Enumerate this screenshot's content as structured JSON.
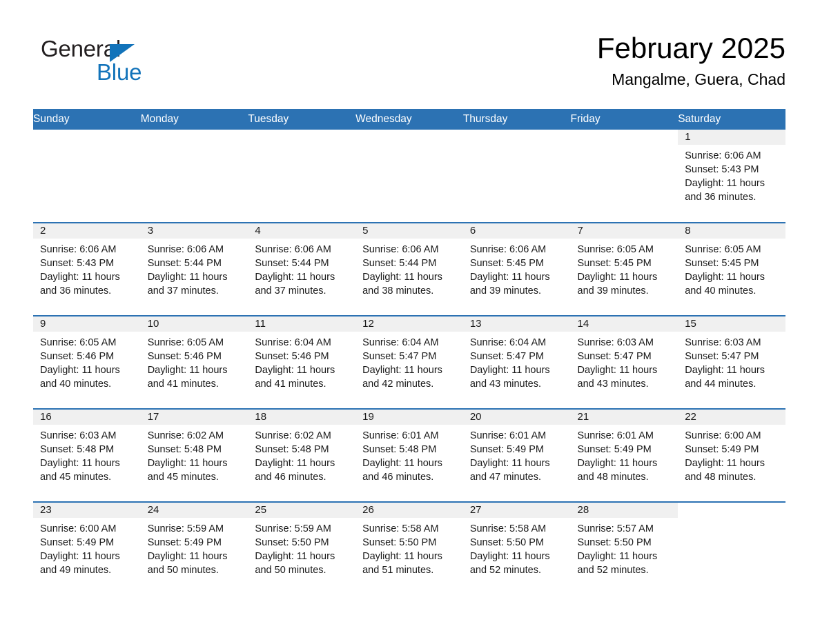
{
  "brand": {
    "name_part1": "General",
    "name_part2": "Blue",
    "logo_icon": "triangle-logo-icon",
    "accent_color": "#1273ba"
  },
  "header": {
    "month_title": "February 2025",
    "location": "Mangalme, Guera, Chad"
  },
  "theme": {
    "header_blue": "#2c72b3",
    "daynum_bg": "#f0f0f0",
    "text_color": "#1a1a1a"
  },
  "weekday_headers": [
    "Sunday",
    "Monday",
    "Tuesday",
    "Wednesday",
    "Thursday",
    "Friday",
    "Saturday"
  ],
  "weeks": [
    [
      {
        "blank": true
      },
      {
        "blank": true
      },
      {
        "blank": true
      },
      {
        "blank": true
      },
      {
        "blank": true
      },
      {
        "blank": true
      },
      {
        "day": "1",
        "sunrise": "Sunrise: 6:06 AM",
        "sunset": "Sunset: 5:43 PM",
        "daylight": "Daylight: 11 hours and 36 minutes."
      }
    ],
    [
      {
        "day": "2",
        "sunrise": "Sunrise: 6:06 AM",
        "sunset": "Sunset: 5:43 PM",
        "daylight": "Daylight: 11 hours and 36 minutes."
      },
      {
        "day": "3",
        "sunrise": "Sunrise: 6:06 AM",
        "sunset": "Sunset: 5:44 PM",
        "daylight": "Daylight: 11 hours and 37 minutes."
      },
      {
        "day": "4",
        "sunrise": "Sunrise: 6:06 AM",
        "sunset": "Sunset: 5:44 PM",
        "daylight": "Daylight: 11 hours and 37 minutes."
      },
      {
        "day": "5",
        "sunrise": "Sunrise: 6:06 AM",
        "sunset": "Sunset: 5:44 PM",
        "daylight": "Daylight: 11 hours and 38 minutes."
      },
      {
        "day": "6",
        "sunrise": "Sunrise: 6:06 AM",
        "sunset": "Sunset: 5:45 PM",
        "daylight": "Daylight: 11 hours and 39 minutes."
      },
      {
        "day": "7",
        "sunrise": "Sunrise: 6:05 AM",
        "sunset": "Sunset: 5:45 PM",
        "daylight": "Daylight: 11 hours and 39 minutes."
      },
      {
        "day": "8",
        "sunrise": "Sunrise: 6:05 AM",
        "sunset": "Sunset: 5:45 PM",
        "daylight": "Daylight: 11 hours and 40 minutes."
      }
    ],
    [
      {
        "day": "9",
        "sunrise": "Sunrise: 6:05 AM",
        "sunset": "Sunset: 5:46 PM",
        "daylight": "Daylight: 11 hours and 40 minutes."
      },
      {
        "day": "10",
        "sunrise": "Sunrise: 6:05 AM",
        "sunset": "Sunset: 5:46 PM",
        "daylight": "Daylight: 11 hours and 41 minutes."
      },
      {
        "day": "11",
        "sunrise": "Sunrise: 6:04 AM",
        "sunset": "Sunset: 5:46 PM",
        "daylight": "Daylight: 11 hours and 41 minutes."
      },
      {
        "day": "12",
        "sunrise": "Sunrise: 6:04 AM",
        "sunset": "Sunset: 5:47 PM",
        "daylight": "Daylight: 11 hours and 42 minutes."
      },
      {
        "day": "13",
        "sunrise": "Sunrise: 6:04 AM",
        "sunset": "Sunset: 5:47 PM",
        "daylight": "Daylight: 11 hours and 43 minutes."
      },
      {
        "day": "14",
        "sunrise": "Sunrise: 6:03 AM",
        "sunset": "Sunset: 5:47 PM",
        "daylight": "Daylight: 11 hours and 43 minutes."
      },
      {
        "day": "15",
        "sunrise": "Sunrise: 6:03 AM",
        "sunset": "Sunset: 5:47 PM",
        "daylight": "Daylight: 11 hours and 44 minutes."
      }
    ],
    [
      {
        "day": "16",
        "sunrise": "Sunrise: 6:03 AM",
        "sunset": "Sunset: 5:48 PM",
        "daylight": "Daylight: 11 hours and 45 minutes."
      },
      {
        "day": "17",
        "sunrise": "Sunrise: 6:02 AM",
        "sunset": "Sunset: 5:48 PM",
        "daylight": "Daylight: 11 hours and 45 minutes."
      },
      {
        "day": "18",
        "sunrise": "Sunrise: 6:02 AM",
        "sunset": "Sunset: 5:48 PM",
        "daylight": "Daylight: 11 hours and 46 minutes."
      },
      {
        "day": "19",
        "sunrise": "Sunrise: 6:01 AM",
        "sunset": "Sunset: 5:48 PM",
        "daylight": "Daylight: 11 hours and 46 minutes."
      },
      {
        "day": "20",
        "sunrise": "Sunrise: 6:01 AM",
        "sunset": "Sunset: 5:49 PM",
        "daylight": "Daylight: 11 hours and 47 minutes."
      },
      {
        "day": "21",
        "sunrise": "Sunrise: 6:01 AM",
        "sunset": "Sunset: 5:49 PM",
        "daylight": "Daylight: 11 hours and 48 minutes."
      },
      {
        "day": "22",
        "sunrise": "Sunrise: 6:00 AM",
        "sunset": "Sunset: 5:49 PM",
        "daylight": "Daylight: 11 hours and 48 minutes."
      }
    ],
    [
      {
        "day": "23",
        "sunrise": "Sunrise: 6:00 AM",
        "sunset": "Sunset: 5:49 PM",
        "daylight": "Daylight: 11 hours and 49 minutes."
      },
      {
        "day": "24",
        "sunrise": "Sunrise: 5:59 AM",
        "sunset": "Sunset: 5:49 PM",
        "daylight": "Daylight: 11 hours and 50 minutes."
      },
      {
        "day": "25",
        "sunrise": "Sunrise: 5:59 AM",
        "sunset": "Sunset: 5:50 PM",
        "daylight": "Daylight: 11 hours and 50 minutes."
      },
      {
        "day": "26",
        "sunrise": "Sunrise: 5:58 AM",
        "sunset": "Sunset: 5:50 PM",
        "daylight": "Daylight: 11 hours and 51 minutes."
      },
      {
        "day": "27",
        "sunrise": "Sunrise: 5:58 AM",
        "sunset": "Sunset: 5:50 PM",
        "daylight": "Daylight: 11 hours and 52 minutes."
      },
      {
        "day": "28",
        "sunrise": "Sunrise: 5:57 AM",
        "sunset": "Sunset: 5:50 PM",
        "daylight": "Daylight: 11 hours and 52 minutes."
      },
      {
        "blank": true
      }
    ]
  ]
}
